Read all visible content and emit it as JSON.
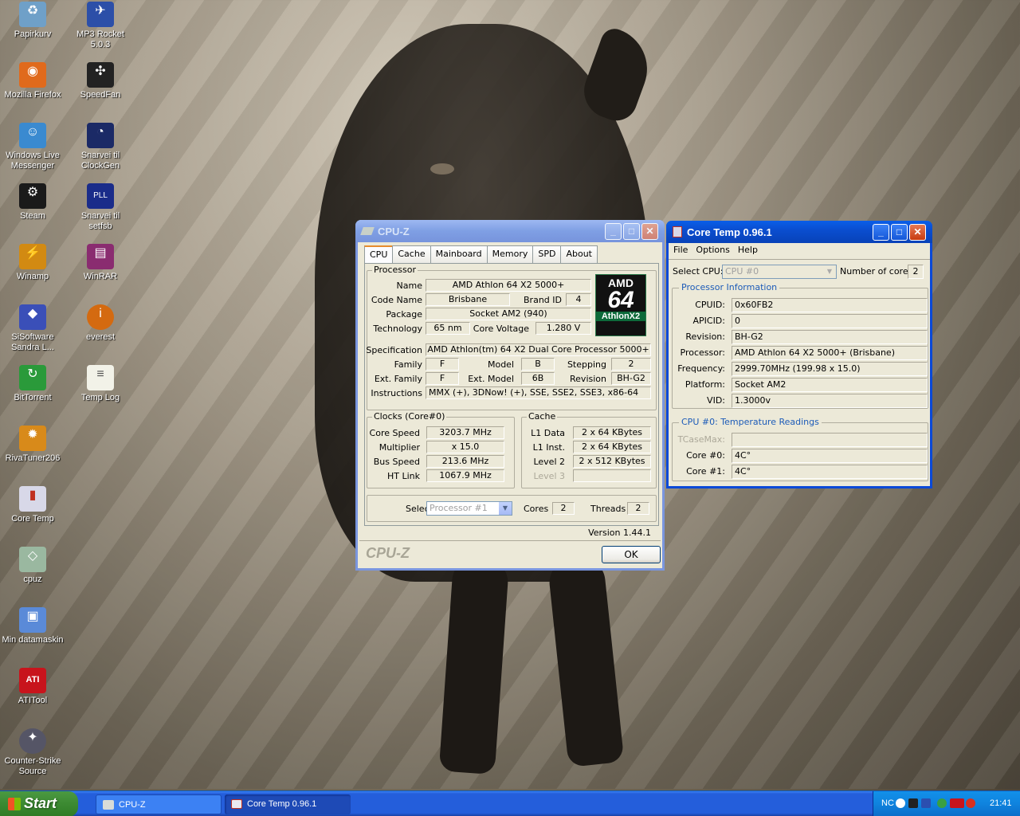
{
  "desktop_icons": [
    {
      "label": "Papirkurv",
      "symbol": "♻",
      "color": "#6fa0c8"
    },
    {
      "label": "MP3 Rocket 5.0.3",
      "symbol": "✈",
      "color": "#2c4fa8"
    },
    {
      "label": "Mozilla Firefox",
      "symbol": "◉",
      "color": "#e06a1c"
    },
    {
      "label": "SpeedFan",
      "symbol": "✣",
      "color": "#222"
    },
    {
      "label": "Windows Live Messenger",
      "symbol": "☺",
      "color": "#3a8ad0"
    },
    {
      "label": "Snarvei til ClockGen",
      "symbol": "◔",
      "color": "#1b2a66"
    },
    {
      "label": "Steam",
      "symbol": "⚙",
      "color": "#1a1a1a"
    },
    {
      "label": "Snarvei til setfsb",
      "symbol": "PLL",
      "color": "#1a2c8a"
    },
    {
      "label": "Winamp",
      "symbol": "⚡",
      "color": "#d28a12"
    },
    {
      "label": "WinRAR",
      "symbol": "▤",
      "color": "#8a2c70"
    },
    {
      "label": "SiSoftware Sandra L...",
      "symbol": "◆",
      "color": "#3a4fb8"
    },
    {
      "label": "everest",
      "symbol": "i",
      "color": "#d46a10"
    },
    {
      "label": "BitTorrent",
      "symbol": "↻",
      "color": "#2a9a3a"
    },
    {
      "label": "Temp Log",
      "symbol": "≡",
      "color": "#f2f2e8"
    },
    {
      "label": "RivaTuner206",
      "symbol": "✹",
      "color": "#d88a1a"
    },
    {
      "label": "Core Temp",
      "symbol": "▮",
      "color": "#d8d8e8"
    },
    {
      "label": "cpuz",
      "symbol": "◇",
      "color": "#9ab8a0"
    },
    {
      "label": "Min datamaskin",
      "symbol": "▣",
      "color": "#5a8ad8"
    },
    {
      "label": "ATITool",
      "symbol": "ATI",
      "color": "#c8141c"
    },
    {
      "label": "Counter-Strike Source",
      "symbol": "✦",
      "color": "#556"
    }
  ],
  "cpuz": {
    "title": "CPU-Z",
    "tabs": [
      "CPU",
      "Cache",
      "Mainboard",
      "Memory",
      "SPD",
      "About"
    ],
    "processor_legend": "Processor",
    "labels": {
      "name": "Name",
      "codename": "Code Name",
      "brand_id": "Brand ID",
      "package": "Package",
      "technology": "Technology",
      "core_voltage": "Core Voltage",
      "specification": "Specification",
      "family": "Family",
      "model": "Model",
      "stepping": "Stepping",
      "ext_family": "Ext. Family",
      "ext_model": "Ext. Model",
      "revision": "Revision",
      "instructions": "Instructions"
    },
    "values": {
      "name": "AMD Athlon 64 X2 5000+",
      "codename": "Brisbane",
      "brand_id": "4",
      "package": "Socket AM2 (940)",
      "technology": "65 nm",
      "core_voltage": "1.280 V",
      "specification": "AMD Athlon(tm) 64 X2 Dual Core Processor 5000+",
      "family": "F",
      "model": "B",
      "stepping": "2",
      "ext_family": "F",
      "ext_model": "6B",
      "revision": "BH-G2",
      "instructions": "MMX (+), 3DNow! (+), SSE, SSE2, SSE3, x86-64"
    },
    "logo": {
      "line1": "AMD",
      "line2": "64",
      "line3": "AthlonX2"
    },
    "clocks_legend": "Clocks (Core#0)",
    "clocks": [
      {
        "label": "Core Speed",
        "value": "3203.7 MHz"
      },
      {
        "label": "Multiplier",
        "value": "x 15.0"
      },
      {
        "label": "Bus Speed",
        "value": "213.6 MHz"
      },
      {
        "label": "HT Link",
        "value": "1067.9 MHz"
      }
    ],
    "cache_legend": "Cache",
    "cache": [
      {
        "label": "L1 Data",
        "value": "2 x 64 KBytes"
      },
      {
        "label": "L1 Inst.",
        "value": "2 x 64 KBytes"
      },
      {
        "label": "Level 2",
        "value": "2 x 512 KBytes"
      },
      {
        "label": "Level 3",
        "value": ""
      }
    ],
    "selection_label": "Selection",
    "selection_value": "Processor #1",
    "cores_label": "Cores",
    "cores_value": "2",
    "threads_label": "Threads",
    "threads_value": "2",
    "version": "Version 1.44.1",
    "brand": "CPU-Z",
    "ok": "OK"
  },
  "coretemp": {
    "title": "Core Temp 0.96.1",
    "menu": [
      "File",
      "Options",
      "Help"
    ],
    "select_cpu_label": "Select CPU:",
    "select_cpu_value": "CPU #0",
    "num_cores_label": "Number of cores",
    "num_cores_value": "2",
    "proc_info_title": "Processor Information",
    "info": [
      {
        "label": "CPUID:",
        "value": "0x60FB2"
      },
      {
        "label": "APICID:",
        "value": "0"
      },
      {
        "label": "Revision:",
        "value": "BH-G2"
      },
      {
        "label": "Processor:",
        "value": "AMD Athlon 64 X2 5000+ (Brisbane)"
      },
      {
        "label": "Frequency:",
        "value": "2999.70MHz (199.98 x 15.0)"
      },
      {
        "label": "Platform:",
        "value": "Socket AM2"
      },
      {
        "label": "VID:",
        "value": "1.3000v"
      }
    ],
    "temp_title": "CPU #0: Temperature Readings",
    "temps": [
      {
        "label": "TCaseMax:",
        "value": ""
      },
      {
        "label": "Core #0:",
        "value": "4C°"
      },
      {
        "label": "Core #1:",
        "value": "4C°"
      }
    ]
  },
  "taskbar": {
    "start": "Start",
    "tasks": [
      "CPU-Z",
      "Core Temp 0.96.1"
    ],
    "tray_text": "NC",
    "clock": "21:41"
  }
}
